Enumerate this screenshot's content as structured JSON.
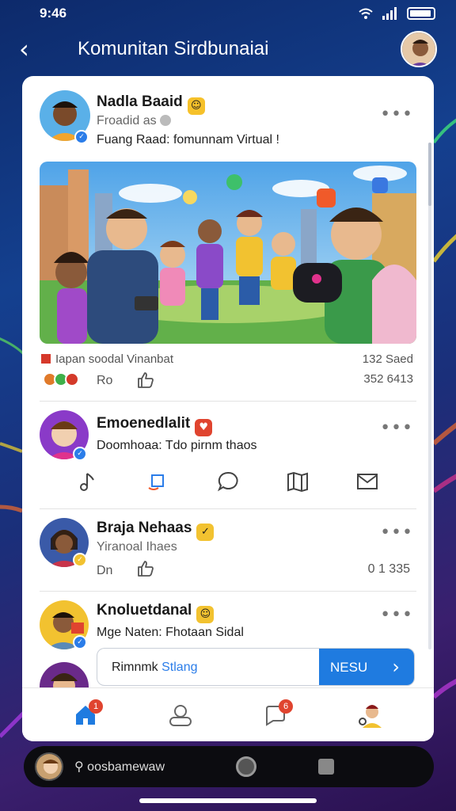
{
  "status_bar": {
    "time": "9:46"
  },
  "header": {
    "title": "Komunitan Sirdbunaiai"
  },
  "posts": [
    {
      "name": "Nadla Baaid",
      "badge": "☺",
      "subtitle": "Froadid as",
      "text": "Fuang Raad: fomunnam Virtual !",
      "caption": "Iapan soodal Vinanbat",
      "caption_right": "132 Saed",
      "reaction_label": "Ro",
      "reaction_count": "352 6413"
    },
    {
      "name": "Emoenedlalit",
      "badge": "♥",
      "text": "Doomhoaa: Tdo pirnm thaos"
    },
    {
      "name": "Braja Nehaas",
      "badge": "✓",
      "subtitle": "Yiranoal Ihaes",
      "reaction_label": "Dn",
      "reaction_count": "0 1 335"
    },
    {
      "name": "Knoluetdanal",
      "badge": "☺",
      "text": "Mge Naten: Fhotaan Sidal"
    }
  ],
  "composer": {
    "text": "Rimnmk",
    "highlight": "Stlang",
    "send_label": "NESU"
  },
  "bottom_nav": {
    "home_badge": "1",
    "chat_badge": "6"
  },
  "system_bar": {
    "search_text": "oosbamewaw"
  },
  "colors": {
    "accent": "#1f7be0",
    "badge_red": "#e0442f"
  }
}
